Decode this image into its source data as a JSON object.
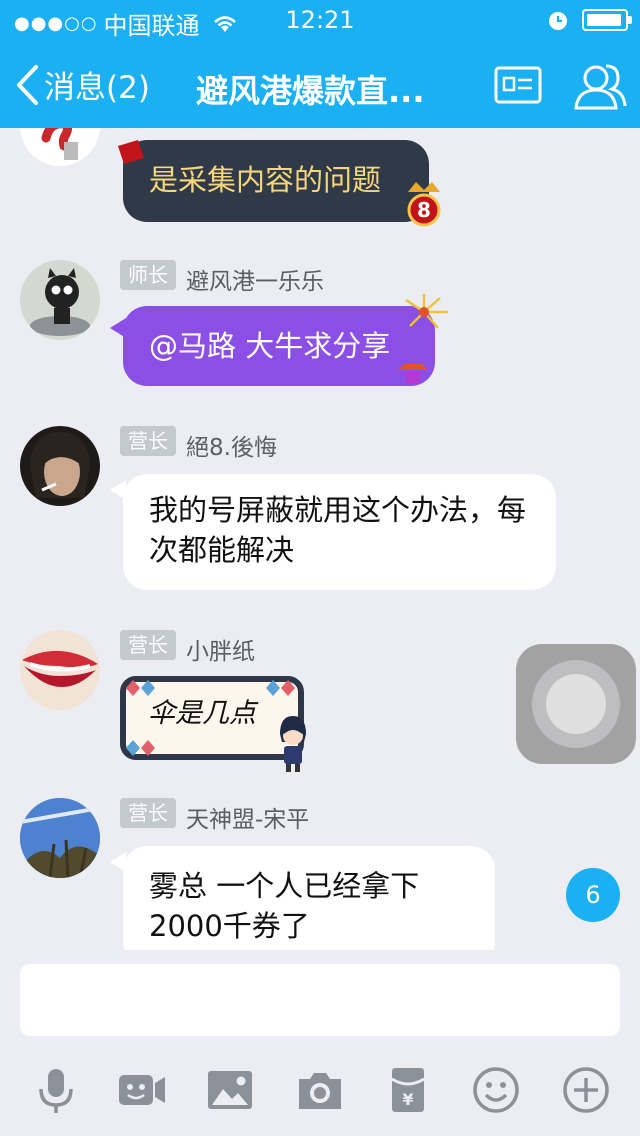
{
  "status_bar": {
    "signal": "●●●○○",
    "carrier": "中国联通",
    "time": "12:21"
  },
  "nav": {
    "back_label": "消息(2)",
    "title": "避风港爆款直..."
  },
  "messages": [
    {
      "text": "是采集内容的问题"
    },
    {
      "badge": "师长",
      "sender": "避风港一乐乐",
      "text": "@马路 大牛求分享"
    },
    {
      "badge": "营长",
      "sender": "絕8.後悔",
      "text": "我的号屏蔽就用这个办法，每次都能解决"
    },
    {
      "badge": "营长",
      "sender": "小胖纸",
      "text": "伞是几点"
    },
    {
      "badge": "营长",
      "sender": "天神盟-宋平",
      "text": "雾总  一个人已经拿下2000千券了"
    }
  ],
  "unread_count": "6",
  "colors": {
    "accent": "#1ab0f2",
    "dark_bubble": "#2f3947",
    "purple_bubble": "#8b4fe6",
    "gold_text": "#f5d67d"
  },
  "toolbar_icons": [
    "microphone-icon",
    "video-icon",
    "image-icon",
    "camera-icon",
    "red-packet-icon",
    "emoji-icon",
    "plus-icon"
  ]
}
